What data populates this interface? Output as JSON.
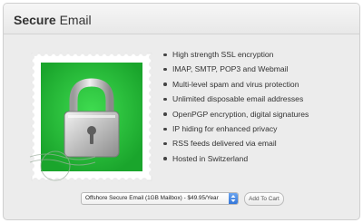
{
  "header": {
    "title_bold": "Secure",
    "title_rest": " Email"
  },
  "stamp": {
    "icon": "padlock-stamp-icon",
    "background_color": "#27c13a"
  },
  "features": [
    "High strength SSL encryption",
    "IMAP, SMTP, POP3 and Webmail",
    "Multi-level spam and virus protection",
    "Unlimited disposable email addresses",
    "OpenPGP encryption, digital signatures",
    "IP hiding for enhanced privacy",
    "RSS feeds delivered via email",
    "Hosted in Switzerland"
  ],
  "order": {
    "selected_plan": "Offshore Secure Email (1GB Mailbox) - $49.95/Year",
    "add_to_cart_label": "Add To Cart"
  }
}
